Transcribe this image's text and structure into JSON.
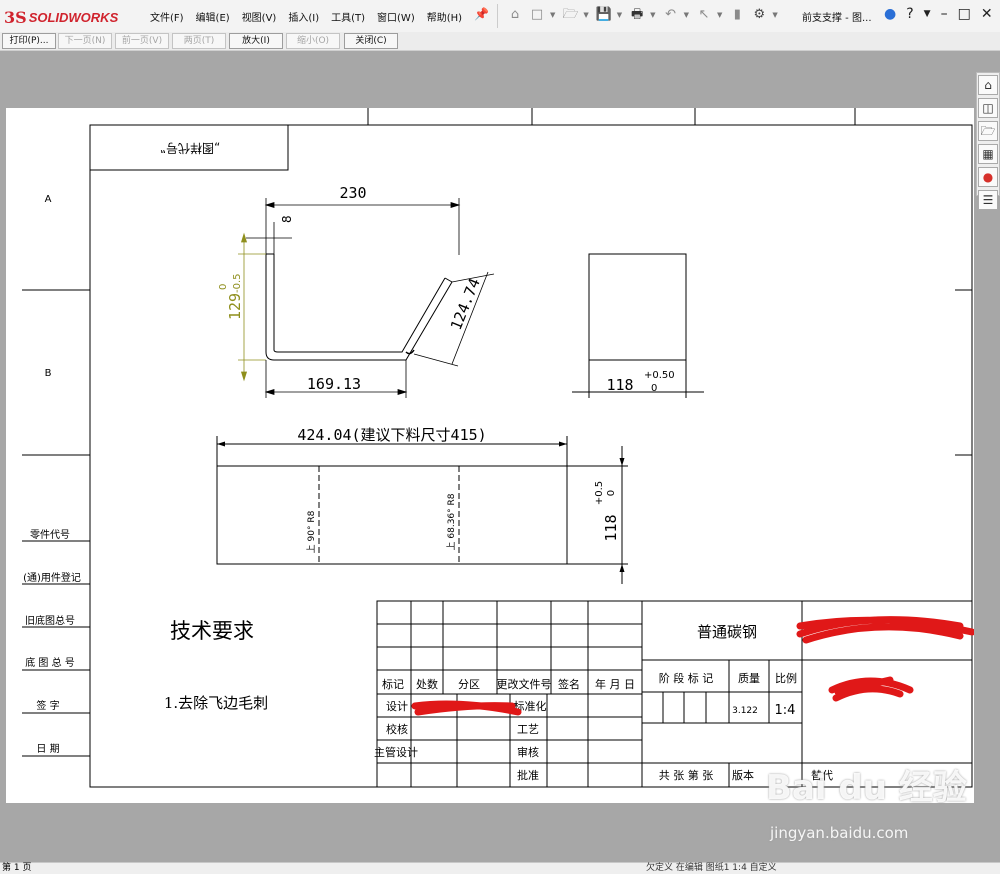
{
  "app": {
    "logo_ds": "3S",
    "logo_name": "SOLIDWORKS",
    "document_title": "前支支撑 - 图...",
    "menu": [
      "文件(F)",
      "编辑(E)",
      "视图(V)",
      "插入(I)",
      "工具(T)",
      "窗口(W)",
      "帮助(H)"
    ],
    "toolbar_icons": [
      "home-icon",
      "new-file-icon",
      "open-icon",
      "save-icon",
      "print-icon",
      "undo-icon",
      "select-icon",
      "rebuild-icon",
      "options-icon"
    ],
    "right_controls": [
      "user-icon",
      "help-icon",
      "minimize-icon",
      "restore-icon",
      "close-icon"
    ]
  },
  "print_preview": {
    "buttons": [
      {
        "label": "打印(P)...",
        "enabled": true
      },
      {
        "label": "下一页(N)",
        "enabled": false
      },
      {
        "label": "前一页(V)",
        "enabled": false
      },
      {
        "label": "两页(T)",
        "enabled": false
      },
      {
        "label": "放大(I)",
        "enabled": true
      },
      {
        "label": "缩小(O)",
        "enabled": false
      },
      {
        "label": "关闭(C)",
        "enabled": true
      }
    ]
  },
  "drawing": {
    "code_box": "„图样代号‟",
    "zone_labels": [
      "A",
      "B"
    ],
    "dim_top_230": "230",
    "dim_8": "8",
    "dim_129": "129",
    "tol_129_upper": "0",
    "tol_129_lower": "-0.5",
    "dim_124_74": "124.74",
    "dim_169_13": "169.13",
    "dim_118": "118",
    "tol_118_upper": "+0.50",
    "tol_118_lower": "0",
    "dim_flat": "424.04(建议下料尺寸415)",
    "bend1_text": "上 90° R8",
    "bend2_text": "上 68.36° R8",
    "dim_118_v": "118",
    "tol_118v_upper": "+0.5",
    "tol_118v_lower": "0",
    "side_labels": [
      "零件代号",
      "(通)用件登记",
      "旧底图总号",
      "底 图 总 号",
      "签   字",
      "日   期"
    ],
    "tech_title": "技术要求",
    "tech_note": "1.去除飞边毛刺",
    "title_block": {
      "material": "普通碳钢",
      "stage_label": "阶 段 标 记",
      "mass_label": "质量",
      "scale_label": "比例",
      "mass_value": "3.122",
      "scale_value": "1:4",
      "row_headers": [
        "标记",
        "处数",
        "分区",
        "更改文件号",
        "签名",
        "年 月 日"
      ],
      "design": "设计",
      "standardize": "标准化",
      "check": "校核",
      "process": "工艺",
      "chief": "主管设计",
      "review": "审核",
      "approve": "批准",
      "sheets": "共  张  第  张",
      "version": "版本",
      "replace": "替代"
    }
  },
  "task_pane_icons": [
    "home-icon",
    "parts-icon",
    "folder-icon",
    "view-palette-icon",
    "appearance-icon",
    "properties-icon"
  ],
  "status": {
    "page": "第 1 页",
    "middle": "欠定义    在编辑 图纸1      1:4      自定义"
  },
  "watermark": {
    "brand": "Bai du 经验",
    "url": "jingyan.baidu.com"
  },
  "colors": {
    "brand_red": "#d0232d",
    "dim_olive": "#8f8f1d",
    "redaction_red": "#e01818"
  }
}
